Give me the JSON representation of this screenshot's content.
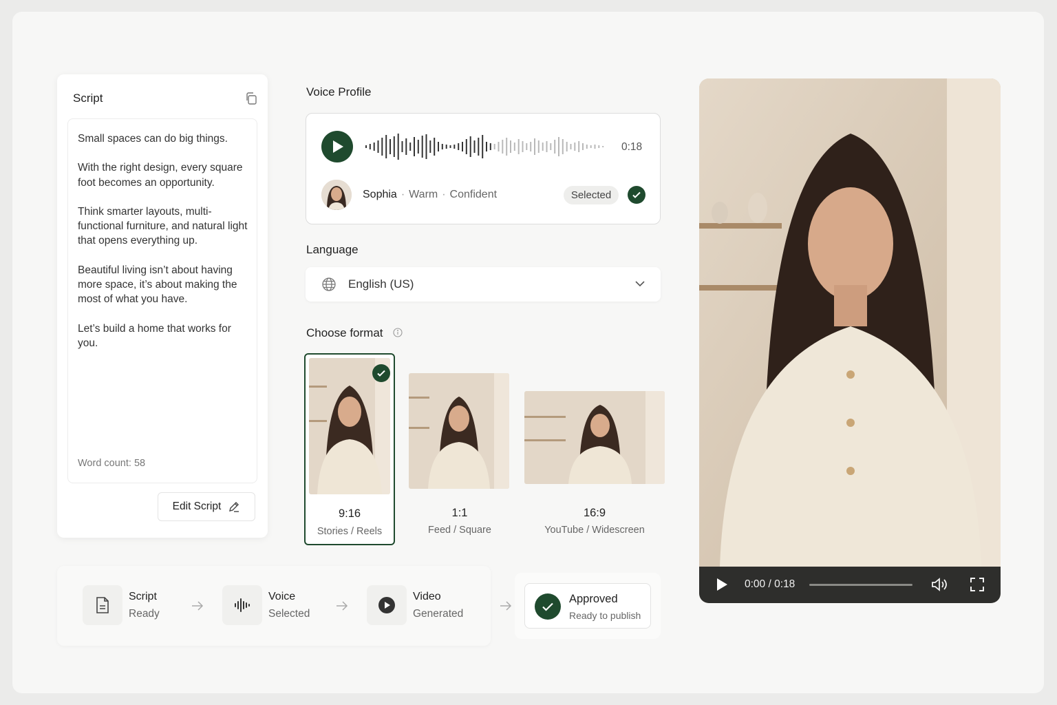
{
  "colors": {
    "accent": "#1f4a2e",
    "background": "#f7f7f6"
  },
  "script": {
    "title": "Script",
    "paragraphs": [
      "Small spaces can do big things.",
      "With the right design, every square foot becomes an opportunity.",
      "Think smarter layouts, multi-functional furniture, and natural light that opens everything up.",
      "Beautiful living isn’t about having more space, it’s about making the most of what you have.",
      "Let’s build a home that works for you."
    ],
    "word_count": "Word count: 58",
    "edit_label": "Edit Script"
  },
  "voice": {
    "section_label": "Voice Profile",
    "duration": "0:18",
    "name": "Sophia",
    "tags": [
      "Warm",
      "Confident"
    ],
    "status": "Selected"
  },
  "language": {
    "section_label": "Language",
    "value": "English (US)"
  },
  "format": {
    "section_label": "Choose format",
    "options": [
      {
        "ratio": "9:16",
        "label": "Stories / Reels",
        "selected": true
      },
      {
        "ratio": "1:1",
        "label": "Feed / Square",
        "selected": false
      },
      {
        "ratio": "16:9",
        "label": "YouTube / Widescreen",
        "selected": false
      }
    ]
  },
  "workflow": {
    "steps": [
      {
        "title": "Script",
        "status": "Ready",
        "icon": "document-icon"
      },
      {
        "title": "Voice",
        "status": "Selected",
        "icon": "waveform-icon"
      },
      {
        "title": "Video",
        "status": "Generated",
        "icon": "play-circle-icon"
      }
    ],
    "final": {
      "title": "Approved",
      "status": "Ready to publish",
      "icon": "check-icon"
    }
  },
  "player": {
    "time": "0:00 / 0:18",
    "progress": 0.0
  }
}
